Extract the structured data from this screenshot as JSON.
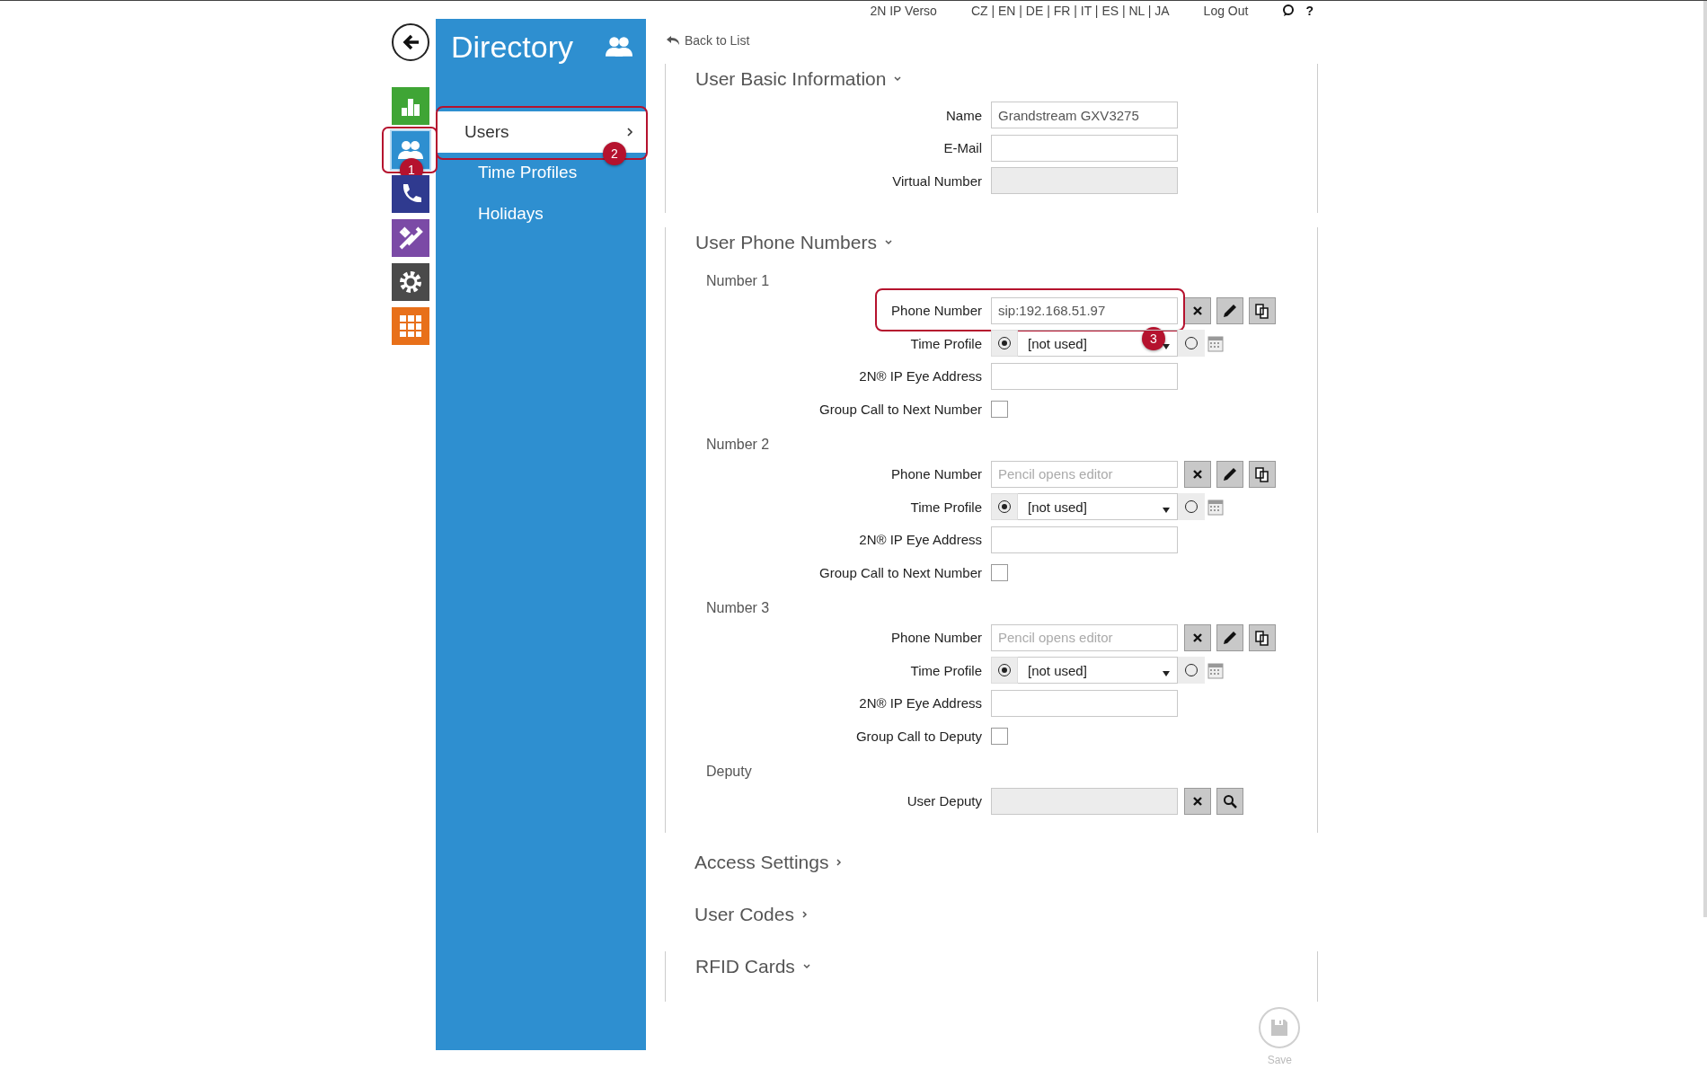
{
  "top_bar": {
    "device": "2N IP Verso",
    "languages": "CZ | EN | DE | FR | IT | ES | NL | JA",
    "logout": "Log Out",
    "help": "?"
  },
  "rail": [
    {
      "kind": "back"
    },
    {
      "kind": "status",
      "color": "#3fa535",
      "selected": false
    },
    {
      "kind": "directory",
      "color": "#2e8fd0",
      "selected": true,
      "callout": "1"
    },
    {
      "kind": "phone",
      "color": "#2f3a8f",
      "selected": false
    },
    {
      "kind": "services",
      "color": "#7b4aa6",
      "selected": false
    },
    {
      "kind": "hardware",
      "color": "#4a4a4a",
      "selected": false
    },
    {
      "kind": "system",
      "color": "#e8701a",
      "selected": false
    }
  ],
  "sidebar": {
    "title": "Directory",
    "items": [
      {
        "label": "Users",
        "selected": true,
        "callout": "2"
      },
      {
        "label": "Time Profiles",
        "selected": false
      },
      {
        "label": "Holidays",
        "selected": false
      }
    ]
  },
  "back_link": "Back to List",
  "sections": [
    {
      "title": "User Basic Information",
      "expanded": true,
      "groups": [
        {
          "fields": [
            {
              "kind": "text",
              "label": "Name",
              "value": "Grandstream GXV3275"
            },
            {
              "kind": "text",
              "label": "E-Mail"
            },
            {
              "kind": "text",
              "label": "Virtual Number",
              "disabled": true
            }
          ]
        }
      ]
    },
    {
      "title": "User Phone Numbers",
      "expanded": true,
      "groups": [
        {
          "subtitle": "Number 1",
          "fields": [
            {
              "kind": "phone",
              "label": "Phone Number",
              "value": "sip:192.168.51.97",
              "callout": "3"
            },
            {
              "kind": "profile",
              "label": "Time Profile",
              "value": "[not used]",
              "profile_on": true
            },
            {
              "kind": "text",
              "label": "2N® IP Eye Address"
            },
            {
              "kind": "checkbox",
              "label": "Group Call to Next Number",
              "checked": false
            }
          ]
        },
        {
          "subtitle": "Number 2",
          "fields": [
            {
              "kind": "phone",
              "label": "Phone Number",
              "placeholder": "Pencil opens editor"
            },
            {
              "kind": "profile",
              "label": "Time Profile",
              "value": "[not used]",
              "profile_on": true
            },
            {
              "kind": "text",
              "label": "2N® IP Eye Address"
            },
            {
              "kind": "checkbox",
              "label": "Group Call to Next Number",
              "checked": false
            }
          ]
        },
        {
          "subtitle": "Number 3",
          "fields": [
            {
              "kind": "phone",
              "label": "Phone Number",
              "placeholder": "Pencil opens editor"
            },
            {
              "kind": "profile",
              "label": "Time Profile",
              "value": "[not used]",
              "profile_on": true
            },
            {
              "kind": "text",
              "label": "2N® IP Eye Address"
            },
            {
              "kind": "checkbox",
              "label": "Group Call to Deputy",
              "checked": false
            }
          ]
        },
        {
          "subtitle": "Deputy",
          "fields": [
            {
              "kind": "deputy",
              "label": "User Deputy",
              "disabled": true
            }
          ]
        }
      ]
    },
    {
      "title": "Access Settings",
      "expanded": false
    },
    {
      "title": "User Codes",
      "expanded": false
    },
    {
      "title": "RFID Cards",
      "expanded": true
    }
  ],
  "save": {
    "label": "Save"
  }
}
